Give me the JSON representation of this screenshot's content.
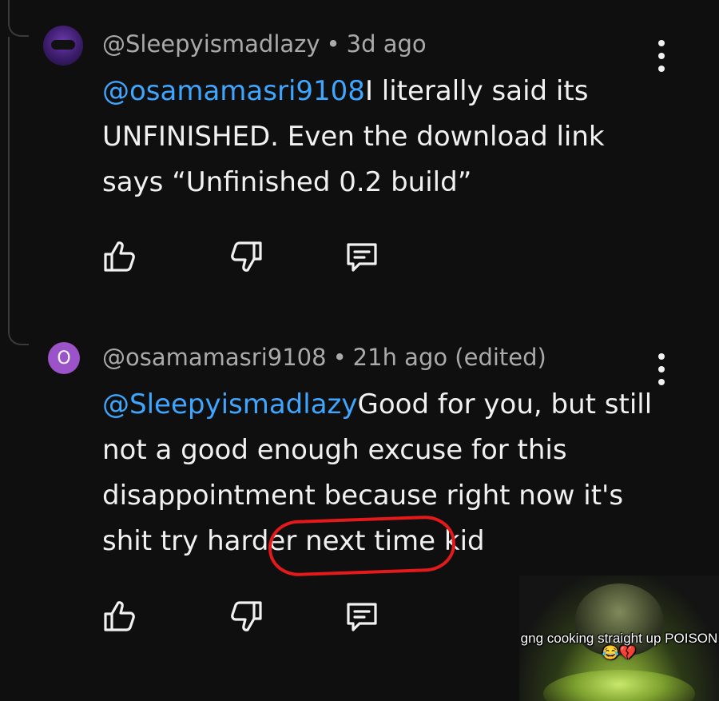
{
  "comments": [
    {
      "author": "@Sleepyismadlazy",
      "separator": "•",
      "time": "3d ago",
      "mention": "@osamamasri9108",
      "text": "I literally said its UNFINISHED. Even the download link says “Unfinished 0.2 build”"
    },
    {
      "avatar_letter": "O",
      "author": "@osamamasri9108",
      "separator": "•",
      "time": "21h ago (edited)",
      "mention": "@Sleepyismadlazy",
      "text": "Good for you, but still not a good enough excuse for this disappointment because right now it's shit try harder next time kid"
    }
  ],
  "actions": {
    "like_icon": "thumbs-up-icon",
    "dislike_icon": "thumbs-down-icon",
    "reply_icon": "reply-comment-icon"
  },
  "meme": {
    "caption": "gng cooking straight up POISON 😂💔"
  },
  "colors": {
    "background": "#0f0f0f",
    "mention": "#3ea6ff",
    "annotation": "#e41a1a"
  }
}
